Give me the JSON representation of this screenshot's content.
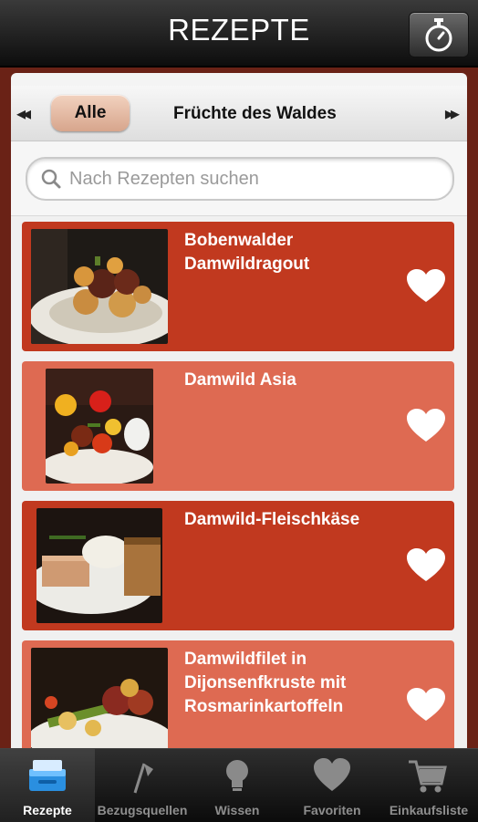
{
  "header": {
    "title": "REZEPTE",
    "timer_icon": "stopwatch-icon"
  },
  "categories": {
    "active": "Alle",
    "next": "Früchte des Waldes",
    "prev_icon": "double-left-arrow",
    "next_icon": "double-right-arrow"
  },
  "search": {
    "placeholder": "Nach Rezepten suchen",
    "icon": "search-icon"
  },
  "recipes": [
    {
      "title": "Bobenwalder Damwildragout",
      "favorite_icon": "heart-icon"
    },
    {
      "title": "Damwild Asia",
      "favorite_icon": "heart-icon"
    },
    {
      "title": "Damwild-Fleischkäse",
      "favorite_icon": "heart-icon"
    },
    {
      "title": "Damwildfilet in Dijonsenfkruste mit Rosmarinkartoffeln",
      "favorite_icon": "heart-icon"
    }
  ],
  "tabs": [
    {
      "label": "Rezepte",
      "icon": "recipe-box-icon",
      "active": true
    },
    {
      "label": "Bezugsquellen",
      "icon": "flag-icon",
      "active": false
    },
    {
      "label": "Wissen",
      "icon": "lightbulb-icon",
      "active": false
    },
    {
      "label": "Favoriten",
      "icon": "heart-icon",
      "active": false
    },
    {
      "label": "Einkaufsliste",
      "icon": "cart-icon",
      "active": false
    }
  ],
  "colors": {
    "card_dark": "#c1391f",
    "card_light": "#de6a52",
    "accent_pill": "#e6bba4"
  }
}
